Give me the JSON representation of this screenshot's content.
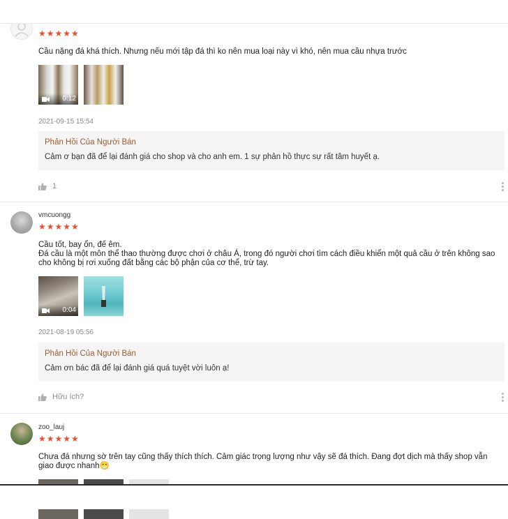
{
  "reviews": [
    {
      "username": "",
      "stars": "★★★★★",
      "comment": "Cầu nặng đá khá thích. Nhưng nếu mới tập đá thì ko nên mua loại này vì khó, nên mua cầu nhựa trước",
      "media": [
        {
          "type": "video",
          "duration": "0:12"
        },
        {
          "type": "image"
        }
      ],
      "date": "2021-09-15 15:54",
      "reply": {
        "title": "Phản Hồi Của Người Bán",
        "text": "Cảm ơ bạn đã để lại đánh giá cho shop và cho anh em. 1 sự phản hồ thực sự rất tâm huyết ạ."
      },
      "likes": "1"
    },
    {
      "username": "vmcuongg",
      "stars": "★★★★★",
      "comment": "Cầu tốt, bay ổn, đế êm.\nĐá cầu là một môn thể thao thường được chơi ở châu Á, trong đó người chơi tìm cách điều khiển một quả cầu ở trên không sao cho không bị rơi xuống đất bằng các bộ phận của cơ thể, trừ tay.",
      "media": [
        {
          "type": "video",
          "duration": "0:04"
        },
        {
          "type": "image"
        }
      ],
      "date": "2021-08-19 05:56",
      "reply": {
        "title": "Phản Hồi Của Người Bán",
        "text": "Cảm ơn bác đã để lại đánh giá quá tuyệt vời luôn ạ!"
      },
      "likes": "Hữu ích?"
    },
    {
      "username": "zoo_lauj",
      "stars": "★★★★★",
      "comment": "Chưa đá nhưng sờ trên tay cũng thấy thích thích. Cảm giác trọng lượng như vậy sẽ đá thích. Đang đợt dịch mà thấy shop vẫn giao được nhanh😁"
    }
  ],
  "icons": {
    "like": "thumbs-up-icon",
    "more": "more-vertical-icon",
    "video": "video-camera-icon",
    "avatar_default": "default-avatar-icon"
  },
  "colors": {
    "star": "#ee4d2d",
    "reply_title": "#a05a2c",
    "reply_bg": "#f5f5f5",
    "muted": "#8a8a8a"
  }
}
